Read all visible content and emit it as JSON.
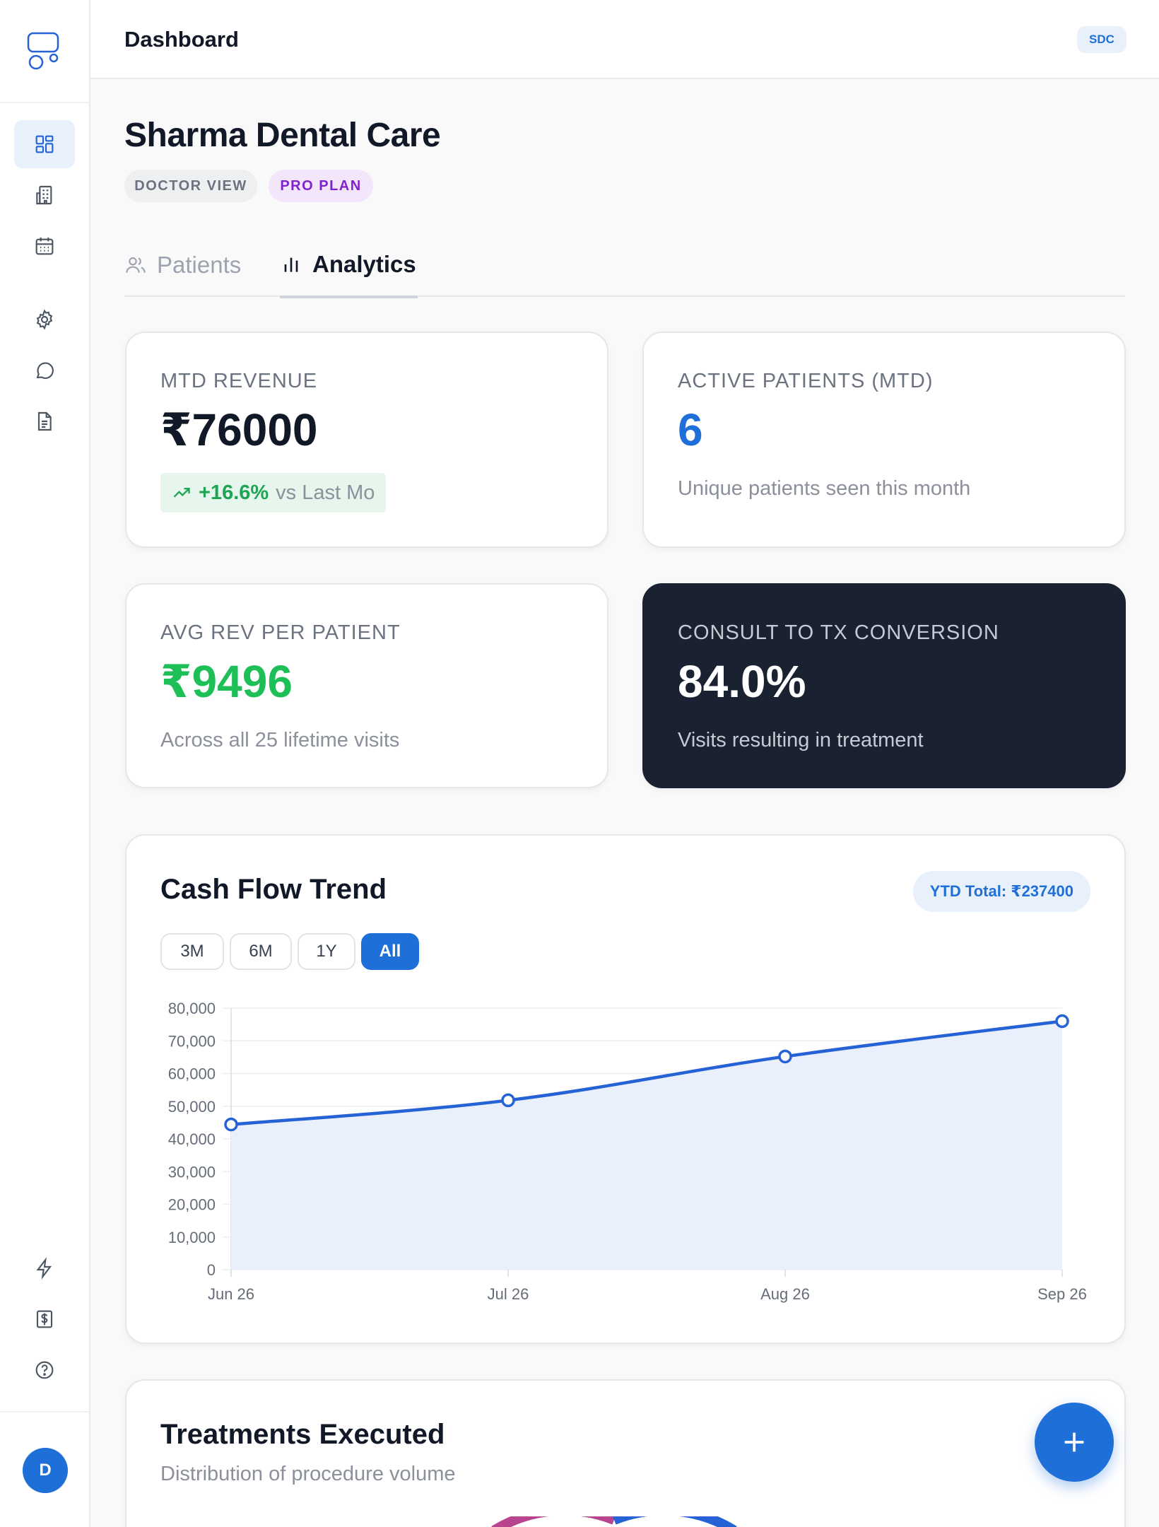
{
  "header": {
    "title": "Dashboard",
    "org_badge": "SDC"
  },
  "sidebar": {
    "top_items": [
      {
        "icon": "dashboard-icon",
        "active": true
      },
      {
        "icon": "building-icon",
        "active": false
      },
      {
        "icon": "calendar-icon",
        "active": false
      },
      {
        "icon": "gear-icon",
        "active": false
      },
      {
        "icon": "chat-icon",
        "active": false
      },
      {
        "icon": "document-icon",
        "active": false
      }
    ],
    "bottom_items": [
      {
        "icon": "lightning-icon"
      },
      {
        "icon": "billing-icon"
      },
      {
        "icon": "help-icon"
      }
    ],
    "avatar": "D"
  },
  "page": {
    "title": "Sharma Dental Care",
    "pills": {
      "view": "DOCTOR VIEW",
      "plan": "PRO PLAN"
    },
    "tabs": [
      {
        "label": "Patients",
        "active": false
      },
      {
        "label": "Analytics",
        "active": true
      }
    ]
  },
  "kpis": {
    "revenue": {
      "label": "MTD REVENUE",
      "value": "₹76000",
      "trend_pct": "+16.6%",
      "trend_text": "vs Last Mo"
    },
    "patients": {
      "label": "ACTIVE PATIENTS (MTD)",
      "value": "6",
      "sub": "Unique patients seen this month"
    },
    "avg": {
      "label": "AVG REV PER PATIENT",
      "value": "₹9496",
      "sub": "Across all 25 lifetime visits"
    },
    "conversion": {
      "label": "CONSULT TO TX CONVERSION",
      "value": "84.0%",
      "sub": "Visits resulting in treatment"
    }
  },
  "cashflow": {
    "title": "Cash Flow Trend",
    "ytd": "YTD Total: ₹237400",
    "ranges": [
      {
        "label": "3M",
        "active": false
      },
      {
        "label": "6M",
        "active": false
      },
      {
        "label": "1Y",
        "active": false
      },
      {
        "label": "All",
        "active": true
      }
    ]
  },
  "chart_data": {
    "type": "area",
    "categories": [
      "Jun 26",
      "Jul 26",
      "Aug 26",
      "Sep 26"
    ],
    "values": [
      44400,
      51800,
      65200,
      76000
    ],
    "ylim": [
      0,
      80000
    ],
    "yticks": [
      "0",
      "10,000",
      "20,000",
      "30,000",
      "40,000",
      "50,000",
      "60,000",
      "70,000",
      "80,000"
    ],
    "grid": true,
    "line_color": "#2462d6",
    "fill_color": "#e9f0fb"
  },
  "treatments": {
    "title": "Treatments Executed",
    "subtitle": "Distribution of procedure volume"
  },
  "colors": {
    "accent": "#1f6fd9",
    "success": "#1fa455",
    "dark_card": "#1a2232",
    "plan": "#7e22ce"
  }
}
